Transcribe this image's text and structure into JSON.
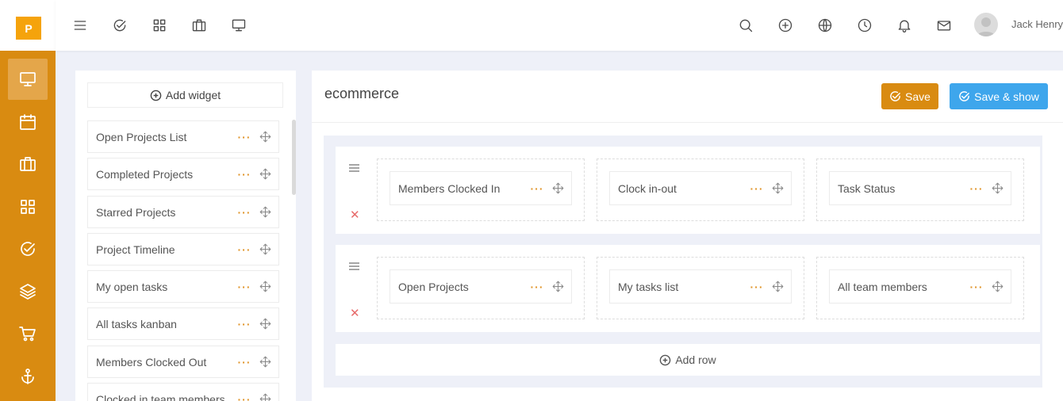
{
  "app": {
    "logo_letter": "P",
    "accent_color": "#d98b11",
    "primary_button_color": "#3ea6ec"
  },
  "rail": {
    "items": [
      {
        "icon": "monitor-icon",
        "active": true
      },
      {
        "icon": "calendar-icon",
        "active": false
      },
      {
        "icon": "briefcase-icon",
        "active": false
      },
      {
        "icon": "grid-icon",
        "active": false
      },
      {
        "icon": "check-circle-icon",
        "active": false
      },
      {
        "icon": "layers-icon",
        "active": false
      },
      {
        "icon": "cart-icon",
        "active": false
      },
      {
        "icon": "anchor-icon",
        "active": false
      }
    ]
  },
  "topbar": {
    "left_icons": [
      "menu-icon",
      "check-circle-icon",
      "grid-icon",
      "briefcase-icon",
      "monitor-icon"
    ],
    "right_icons": [
      "search-icon",
      "plus-circle-icon",
      "globe-icon",
      "clock-icon",
      "bell-icon",
      "mail-icon"
    ],
    "user_name": "Jack Henry"
  },
  "widget_panel": {
    "add_widget_label": "Add widget",
    "items": [
      {
        "label": "Open Projects List"
      },
      {
        "label": "Completed Projects"
      },
      {
        "label": "Starred Projects"
      },
      {
        "label": "Project Timeline"
      },
      {
        "label": "My open tasks"
      },
      {
        "label": "All tasks kanban"
      },
      {
        "label": "Members Clocked Out"
      },
      {
        "label": "Clocked in team members"
      }
    ]
  },
  "dashboard": {
    "title": "ecommerce",
    "save_label": "Save",
    "save_show_label": "Save & show",
    "rows": [
      {
        "cells": [
          {
            "label": "Members Clocked In"
          },
          {
            "label": "Clock in-out"
          },
          {
            "label": "Task Status"
          }
        ]
      },
      {
        "cells": [
          {
            "label": "Open Projects"
          },
          {
            "label": "My tasks list"
          },
          {
            "label": "All team members"
          }
        ]
      }
    ],
    "add_row_label": "Add row",
    "remove_symbol": "✕",
    "dots_symbol": "···"
  }
}
